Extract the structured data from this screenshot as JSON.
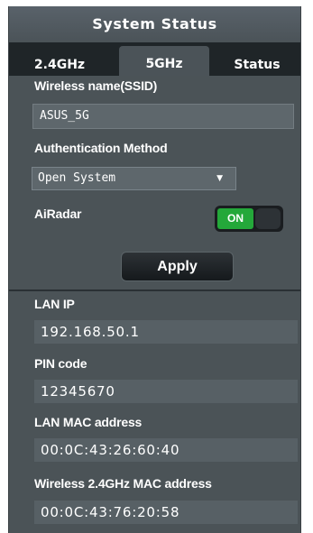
{
  "window": {
    "title": "System Status"
  },
  "tabs": [
    {
      "label": "2.4GHz"
    },
    {
      "label": "5GHz",
      "active": true
    },
    {
      "label": "Status"
    }
  ],
  "wireless": {
    "ssid_label": "Wireless name(SSID)",
    "ssid_value": "ASUS_5G",
    "auth_label": "Authentication Method",
    "auth_value": "Open System",
    "airadar_label": "AiRadar",
    "airadar_toggle": "ON",
    "apply_label": "Apply"
  },
  "status": {
    "lan_ip_label": "LAN IP",
    "lan_ip_value": "192.168.50.1",
    "pin_label": "PIN code",
    "pin_value": "12345670",
    "lan_mac_label": "LAN MAC address",
    "lan_mac_value": "00:0C:43:26:60:40",
    "wl_mac_label": "Wireless 2.4GHz MAC address",
    "wl_mac_value": "00:0C:43:76:20:58"
  },
  "colors": {
    "panel_bg": "#4b5357",
    "tab_bar_bg": "#1f2528",
    "toggle_on": "#24a83a"
  },
  "icons": {
    "dropdown": "caret-down-icon"
  }
}
